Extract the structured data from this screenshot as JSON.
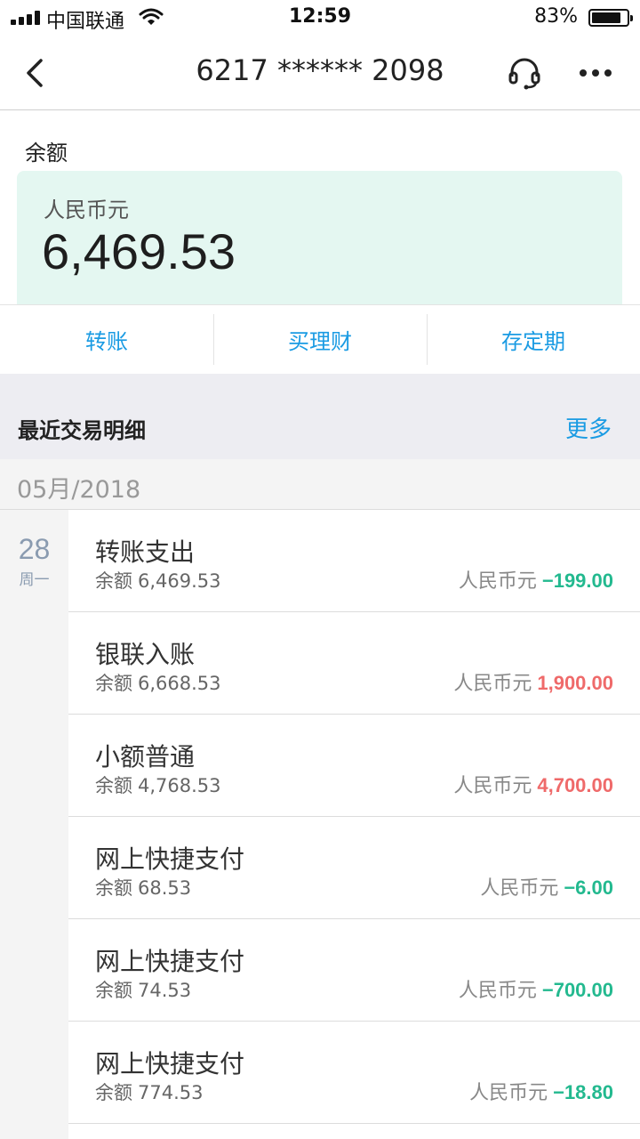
{
  "status_bar": {
    "carrier": "中国联通",
    "time": "12:59",
    "battery_percent": "83%",
    "battery_level": 0.83
  },
  "nav": {
    "title": "6217 ****** 2098"
  },
  "balance": {
    "label": "余额",
    "currency": "人民币元",
    "amount": "6,469.53"
  },
  "actions": [
    "转账",
    "买理财",
    "存定期"
  ],
  "recent": {
    "title": "最近交易明细",
    "more": "更多",
    "month": "05月/2018",
    "day": "28",
    "weekday": "周一",
    "balance_label": "余额",
    "currency": "人民币元",
    "transactions": [
      {
        "title": "转账支出",
        "balance": "6,469.53",
        "amount": "−199.00",
        "type": "neg"
      },
      {
        "title": "银联入账",
        "balance": "6,668.53",
        "amount": "1,900.00",
        "type": "pos"
      },
      {
        "title": "小额普通",
        "balance": "4,768.53",
        "amount": "4,700.00",
        "type": "pos"
      },
      {
        "title": "网上快捷支付",
        "balance": "68.53",
        "amount": "−6.00",
        "type": "neg"
      },
      {
        "title": "网上快捷支付",
        "balance": "74.53",
        "amount": "−700.00",
        "type": "neg"
      },
      {
        "title": "网上快捷支付",
        "balance": "774.53",
        "amount": "−18.80",
        "type": "neg"
      }
    ]
  },
  "colors": {
    "accent": "#1a9be3",
    "negative": "#23b98f",
    "positive": "#ef6a6a",
    "balance_card": "#e4f7f1"
  },
  "icons": [
    "signal-icon",
    "wifi-icon",
    "battery-icon",
    "back-icon",
    "headset-icon",
    "more-icon"
  ]
}
